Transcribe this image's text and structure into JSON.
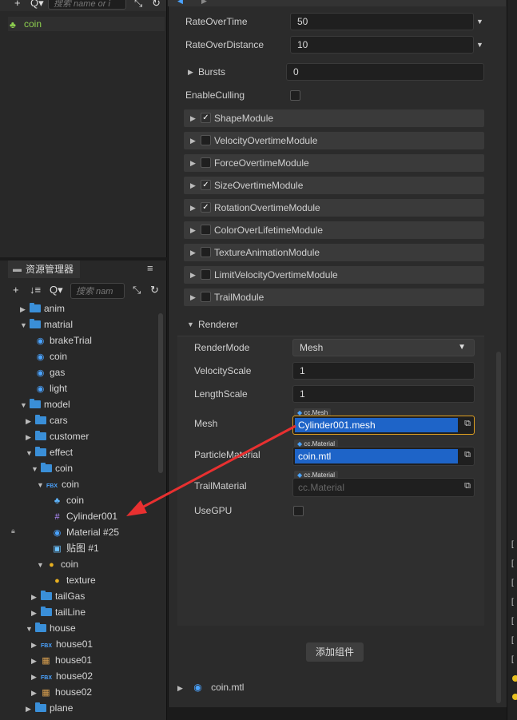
{
  "hierarchy": {
    "search_placeholder": "搜索 name or i",
    "selected_node": "coin"
  },
  "assets": {
    "tab_label": "资源管理器",
    "search_placeholder": "搜索 nam",
    "tree": [
      {
        "label": "anim",
        "indent": 1,
        "arrow": "▶",
        "icon": "folder"
      },
      {
        "label": "matrial",
        "indent": 1,
        "arrow": "▼",
        "icon": "folder"
      },
      {
        "label": "brakeTrial",
        "indent": 2,
        "arrow": "",
        "icon": "material"
      },
      {
        "label": "coin",
        "indent": 2,
        "arrow": "",
        "icon": "material"
      },
      {
        "label": "gas",
        "indent": 2,
        "arrow": "",
        "icon": "material"
      },
      {
        "label": "light",
        "indent": 2,
        "arrow": "",
        "icon": "material"
      },
      {
        "label": "model",
        "indent": 1,
        "arrow": "▼",
        "icon": "folder"
      },
      {
        "label": "cars",
        "indent": 2,
        "arrow": "▶",
        "icon": "folder"
      },
      {
        "label": "customer",
        "indent": 2,
        "arrow": "▶",
        "icon": "folder"
      },
      {
        "label": "effect",
        "indent": 2,
        "arrow": "▼",
        "icon": "folder"
      },
      {
        "label": "coin",
        "indent": 3,
        "arrow": "▼",
        "icon": "folder"
      },
      {
        "label": "coin",
        "indent": 4,
        "arrow": "▼",
        "icon": "fbx"
      },
      {
        "label": "coin",
        "indent": 5,
        "arrow": "",
        "icon": "prefab"
      },
      {
        "label": "Cylinder001",
        "indent": 5,
        "arrow": "",
        "icon": "mesh"
      },
      {
        "label": "Material #25",
        "indent": 5,
        "arrow": "",
        "icon": "material"
      },
      {
        "label": "贴图 #1",
        "indent": 5,
        "arrow": "",
        "icon": "image"
      },
      {
        "label": "coin",
        "indent": 4,
        "arrow": "▼",
        "icon": "coin"
      },
      {
        "label": "texture",
        "indent": 5,
        "arrow": "",
        "icon": "coin"
      },
      {
        "label": "tailGas",
        "indent": 3,
        "arrow": "▶",
        "icon": "folder"
      },
      {
        "label": "tailLine",
        "indent": 3,
        "arrow": "▶",
        "icon": "folder"
      },
      {
        "label": "house",
        "indent": 2,
        "arrow": "▼",
        "icon": "folder"
      },
      {
        "label": "house01",
        "indent": 3,
        "arrow": "▶",
        "icon": "fbx"
      },
      {
        "label": "house01",
        "indent": 3,
        "arrow": "▶",
        "icon": "texture"
      },
      {
        "label": "house02",
        "indent": 3,
        "arrow": "▶",
        "icon": "fbx"
      },
      {
        "label": "house02",
        "indent": 3,
        "arrow": "▶",
        "icon": "texture"
      },
      {
        "label": "plane",
        "indent": 2,
        "arrow": "▶",
        "icon": "folder"
      }
    ]
  },
  "inspector": {
    "rate_over_time": {
      "label": "RateOverTime",
      "value": "50"
    },
    "rate_over_distance": {
      "label": "RateOverDistance",
      "value": "10"
    },
    "bursts": {
      "label": "Bursts",
      "value": "0"
    },
    "enable_culling": {
      "label": "EnableCulling"
    },
    "modules": [
      {
        "label": "ShapeModule",
        "checked": true
      },
      {
        "label": "VelocityOvertimeModule",
        "checked": false
      },
      {
        "label": "ForceOvertimeModule",
        "checked": false
      },
      {
        "label": "SizeOvertimeModule",
        "checked": true
      },
      {
        "label": "RotationOvertimeModule",
        "checked": true
      },
      {
        "label": "ColorOverLifetimeModule",
        "checked": false
      },
      {
        "label": "TextureAnimationModule",
        "checked": false
      },
      {
        "label": "LimitVelocityOvertimeModule",
        "checked": false
      },
      {
        "label": "TrailModule",
        "checked": false
      }
    ],
    "renderer": {
      "header": "Renderer",
      "render_mode": {
        "label": "RenderMode",
        "value": "Mesh"
      },
      "velocity_scale": {
        "label": "VelocityScale",
        "value": "1"
      },
      "length_scale": {
        "label": "LengthScale",
        "value": "1"
      },
      "mesh": {
        "label": "Mesh",
        "type": "cc.Mesh",
        "value": "Cylinder001.mesh"
      },
      "particle_material": {
        "label": "ParticleMaterial",
        "type": "cc.Material",
        "value": "coin.mtl"
      },
      "trail_material": {
        "label": "TrailMaterial",
        "type": "cc.Material",
        "value": "cc.Material"
      },
      "use_gpu": {
        "label": "UseGPU"
      }
    },
    "add_component": "添加组件",
    "footer_material": "coin.mtl"
  },
  "right_strip": {
    "rows": [
      "[",
      "[",
      "[",
      "[",
      "[",
      "[",
      "["
    ]
  },
  "colors": {
    "accent": "#1e64c8",
    "selected_text": "#8fd14f",
    "arrow": "#e83030",
    "highlight_border": "#e0a020"
  }
}
